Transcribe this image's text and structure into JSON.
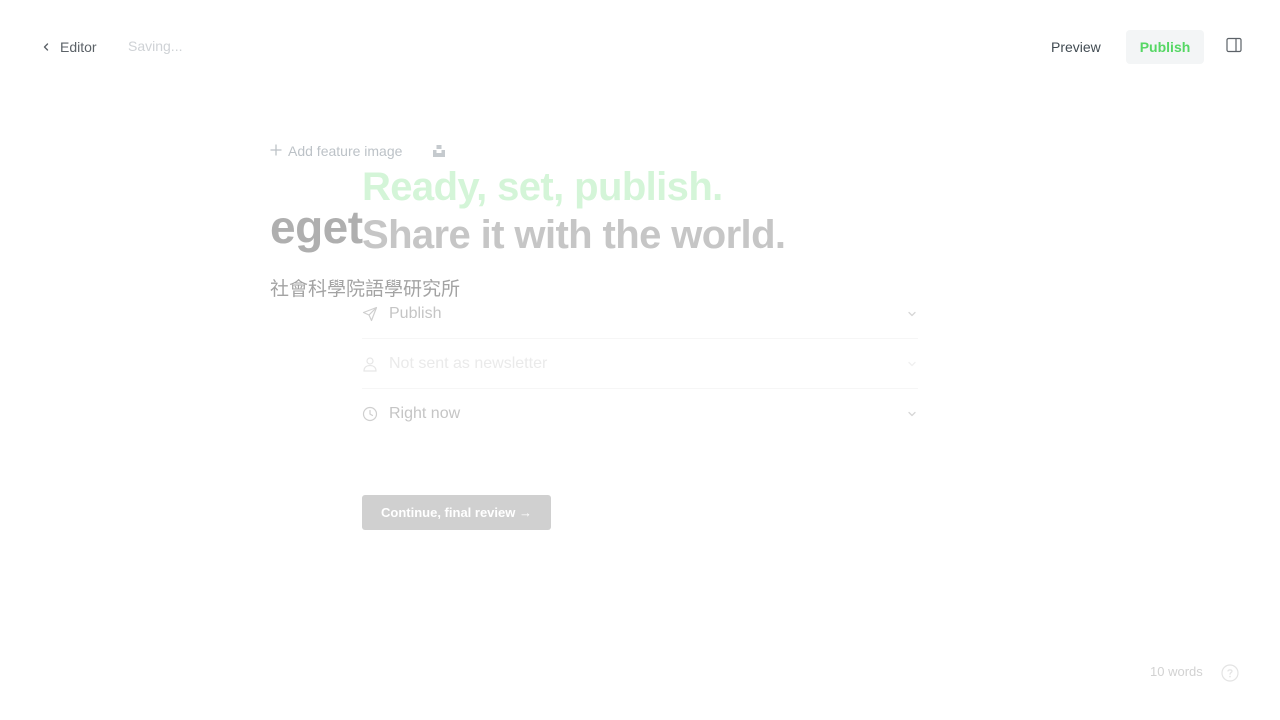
{
  "topbar": {
    "back_label": "Editor",
    "status": "Saving...",
    "preview_label": "Preview",
    "publish_label": "Publish"
  },
  "editor": {
    "feature_image_label": "Add feature image",
    "title": "eget",
    "body": "社會科學院語學研究所"
  },
  "publish_flow": {
    "heading_line1": "Ready, set, publish.",
    "heading_line2": "Share it with the world.",
    "options": [
      {
        "label": "Publish",
        "icon": "send-icon"
      },
      {
        "label": "Not sent as newsletter",
        "icon": "user-icon"
      },
      {
        "label": "Right now",
        "icon": "clock-icon"
      }
    ],
    "continue_label": "Continue, final review →"
  },
  "footer": {
    "word_count": "10 words"
  },
  "colors": {
    "accent_green": "#30cf43",
    "heading_green_faded": "#d4f5d8",
    "button_grey": "#d0d0d0"
  }
}
